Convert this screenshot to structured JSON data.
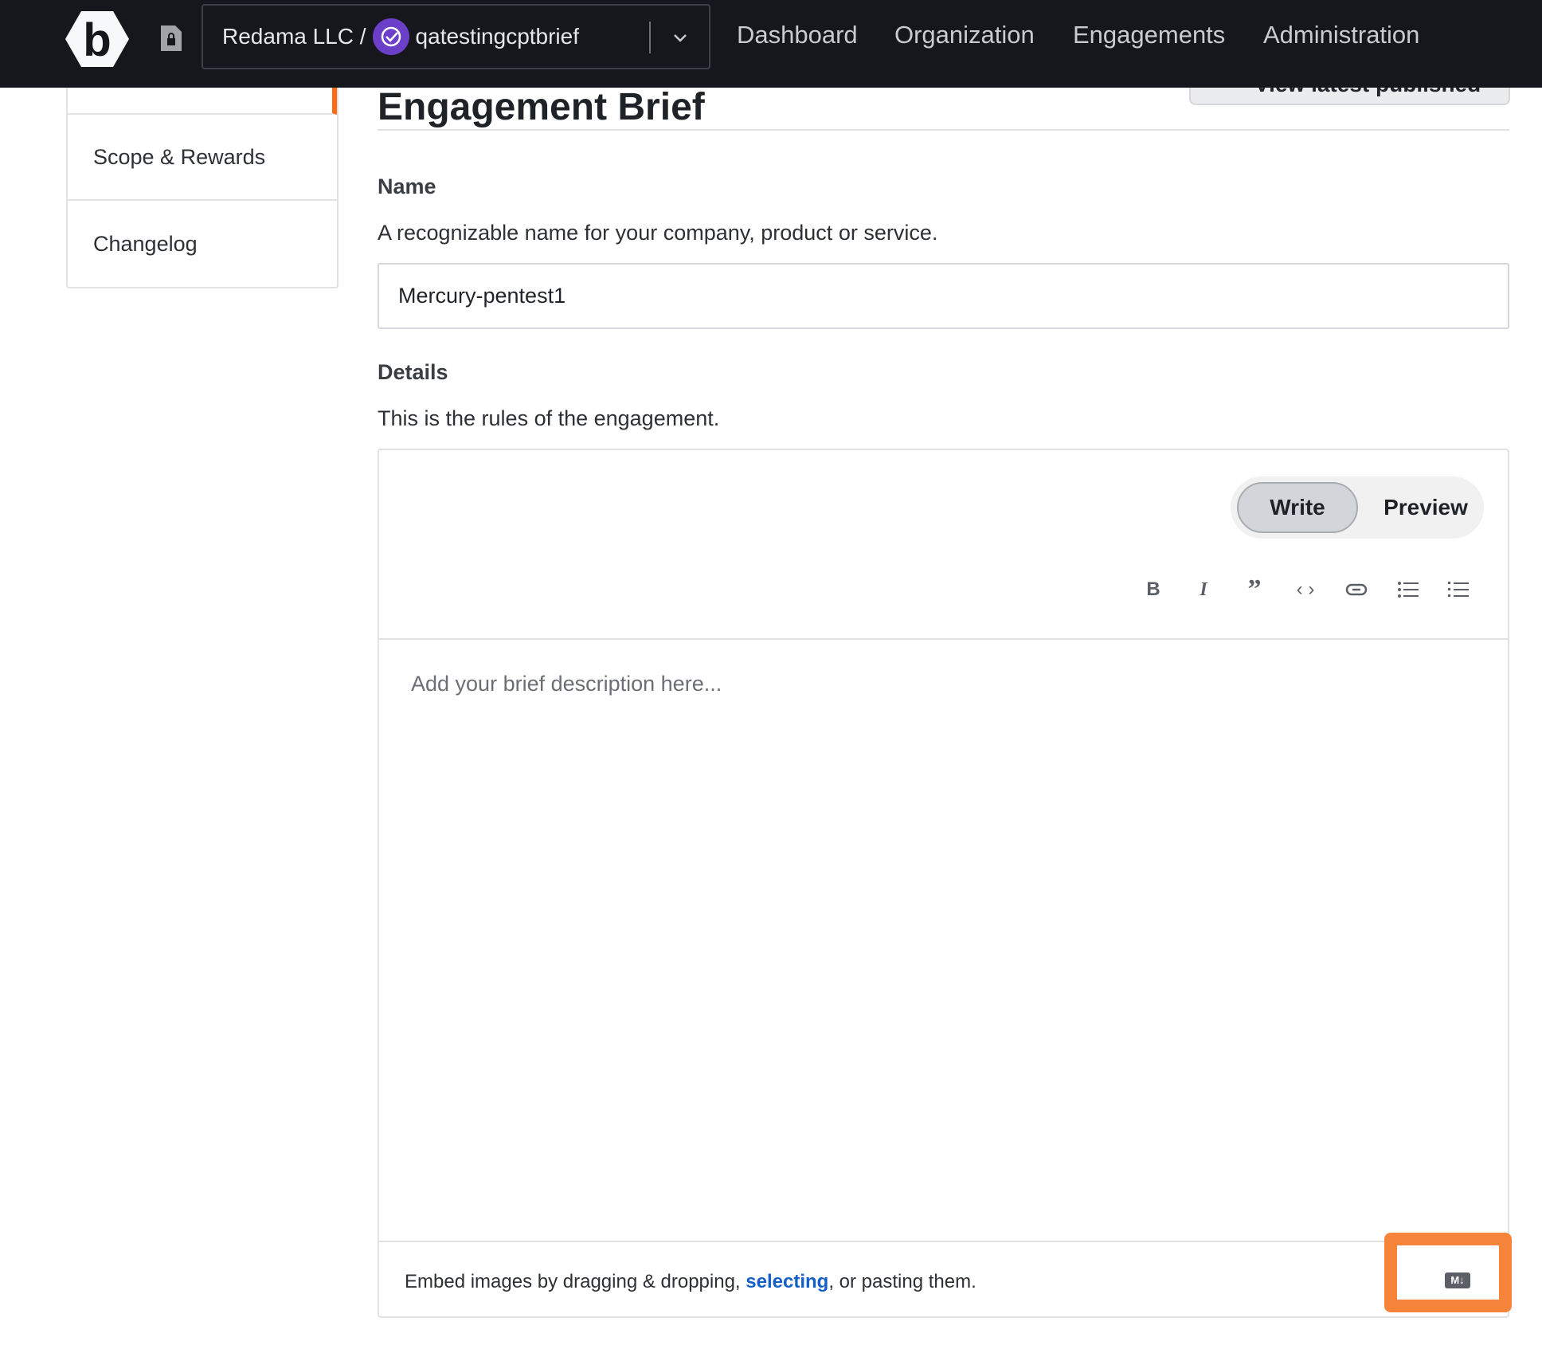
{
  "header": {
    "org_name": "Redama LLC /",
    "program_name": "qatestingcptbrief",
    "nav": [
      "Dashboard",
      "Organization",
      "Engagements",
      "Administration"
    ]
  },
  "sidebar": {
    "items": [
      "Scope & Rewards",
      "Changelog"
    ]
  },
  "main": {
    "title": "Engagement Brief",
    "view_button": "View latest published",
    "name_label": "Name",
    "name_help": "A recognizable name for your company, product or service.",
    "name_value": "Mercury-pentest1",
    "details_label": "Details",
    "details_help": "This is the rules of the engagement.",
    "editor": {
      "tabs": [
        "Write",
        "Preview"
      ],
      "active_tab": "Write",
      "toolbar": [
        "bold-icon",
        "italic-icon",
        "quote-icon",
        "code-icon",
        "link-icon",
        "bullet-list-icon",
        "numbered-list-icon"
      ],
      "placeholder": "Add your brief description here...",
      "footer_pre": "Embed images by dragging & dropping, ",
      "footer_link": "selecting",
      "footer_post": ", or pasting them.",
      "markdown_badge": "M↓"
    }
  },
  "colors": {
    "header_bg": "#15171c",
    "accent": "#ff6a13",
    "highlight": "#f6843b",
    "link": "#1460c8",
    "badge": "#6c3fc9"
  }
}
